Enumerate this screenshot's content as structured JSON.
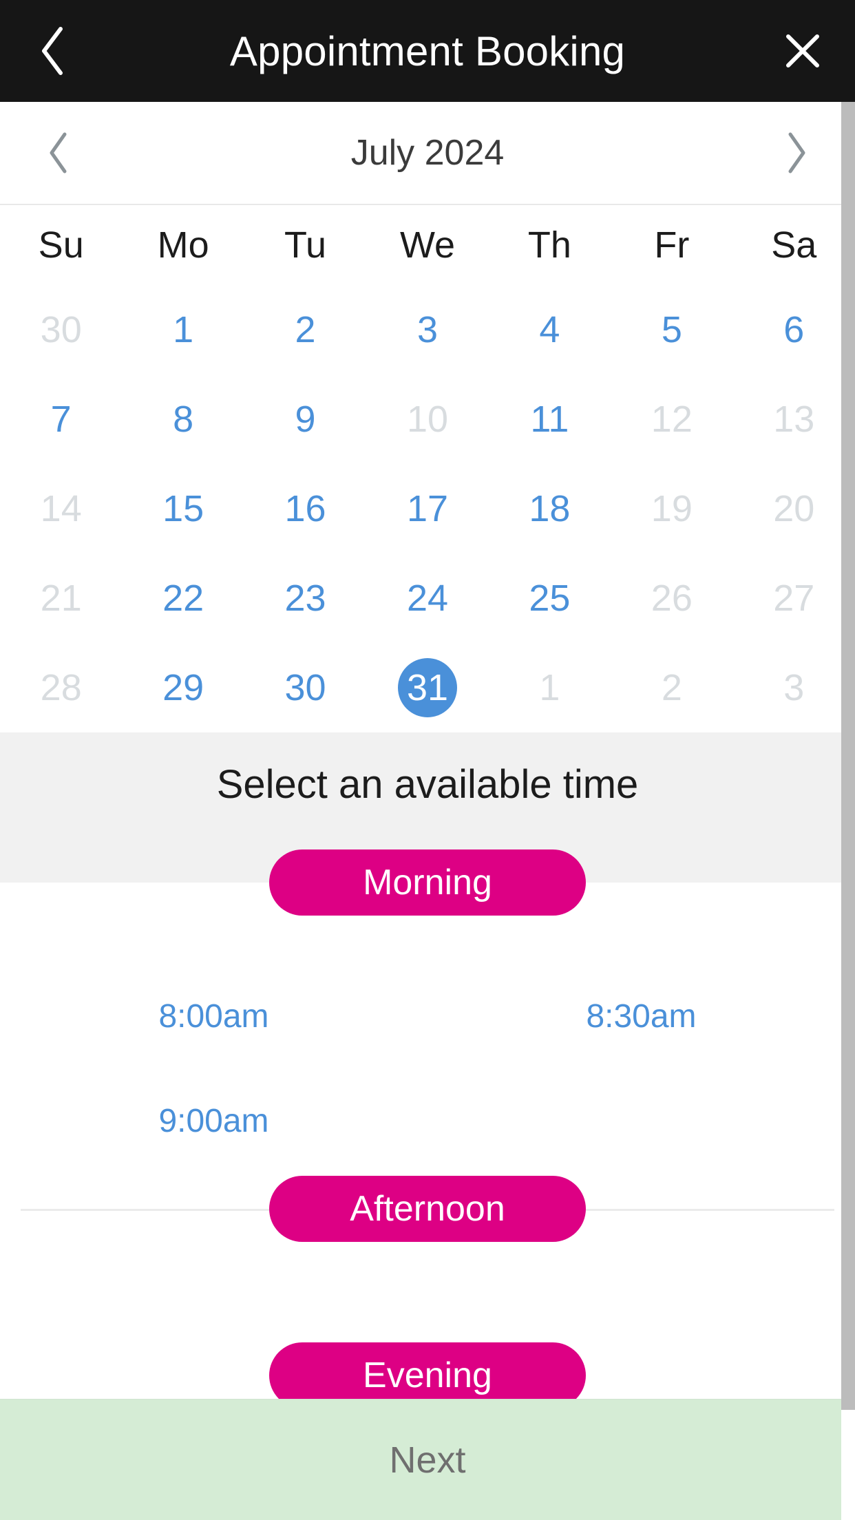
{
  "header": {
    "title": "Appointment Booking",
    "back_icon": "chevron-left-icon",
    "close_icon": "close-x-icon"
  },
  "calendar": {
    "month_label": "July 2024",
    "prev_icon": "chevron-left-icon",
    "next_icon": "chevron-right-icon",
    "weekday_headers": [
      "Su",
      "Mo",
      "Tu",
      "We",
      "Th",
      "Fr",
      "Sa"
    ],
    "weeks": [
      [
        {
          "label": "30",
          "state": "disabled"
        },
        {
          "label": "1",
          "state": "enabled"
        },
        {
          "label": "2",
          "state": "enabled"
        },
        {
          "label": "3",
          "state": "enabled"
        },
        {
          "label": "4",
          "state": "enabled"
        },
        {
          "label": "5",
          "state": "enabled"
        },
        {
          "label": "6",
          "state": "enabled"
        }
      ],
      [
        {
          "label": "7",
          "state": "enabled"
        },
        {
          "label": "8",
          "state": "enabled"
        },
        {
          "label": "9",
          "state": "enabled"
        },
        {
          "label": "10",
          "state": "disabled"
        },
        {
          "label": "11",
          "state": "enabled"
        },
        {
          "label": "12",
          "state": "disabled"
        },
        {
          "label": "13",
          "state": "disabled"
        }
      ],
      [
        {
          "label": "14",
          "state": "disabled"
        },
        {
          "label": "15",
          "state": "enabled"
        },
        {
          "label": "16",
          "state": "enabled"
        },
        {
          "label": "17",
          "state": "enabled"
        },
        {
          "label": "18",
          "state": "enabled"
        },
        {
          "label": "19",
          "state": "disabled"
        },
        {
          "label": "20",
          "state": "disabled"
        }
      ],
      [
        {
          "label": "21",
          "state": "disabled"
        },
        {
          "label": "22",
          "state": "enabled"
        },
        {
          "label": "23",
          "state": "enabled"
        },
        {
          "label": "24",
          "state": "enabled"
        },
        {
          "label": "25",
          "state": "enabled"
        },
        {
          "label": "26",
          "state": "disabled"
        },
        {
          "label": "27",
          "state": "disabled"
        }
      ],
      [
        {
          "label": "28",
          "state": "disabled"
        },
        {
          "label": "29",
          "state": "enabled"
        },
        {
          "label": "30",
          "state": "enabled"
        },
        {
          "label": "31",
          "state": "selected"
        },
        {
          "label": "1",
          "state": "disabled"
        },
        {
          "label": "2",
          "state": "disabled"
        },
        {
          "label": "3",
          "state": "disabled"
        }
      ]
    ]
  },
  "time_section": {
    "title": "Select an available time",
    "groups": [
      {
        "label": "Morning",
        "slots": [
          "8:00am",
          "8:30am",
          "9:00am"
        ]
      },
      {
        "label": "Afternoon",
        "slots": []
      },
      {
        "label": "Evening",
        "slots": []
      }
    ]
  },
  "footer": {
    "next_label": "Next"
  },
  "colors": {
    "header_bg": "#161616",
    "accent_blue": "#4a90d9",
    "disabled_gray": "#d8dcdf",
    "pill_magenta": "#dd0084",
    "band_gray": "#f1f1f1",
    "footer_green": "#d5ecd5",
    "footer_text": "#6f6f6f"
  }
}
